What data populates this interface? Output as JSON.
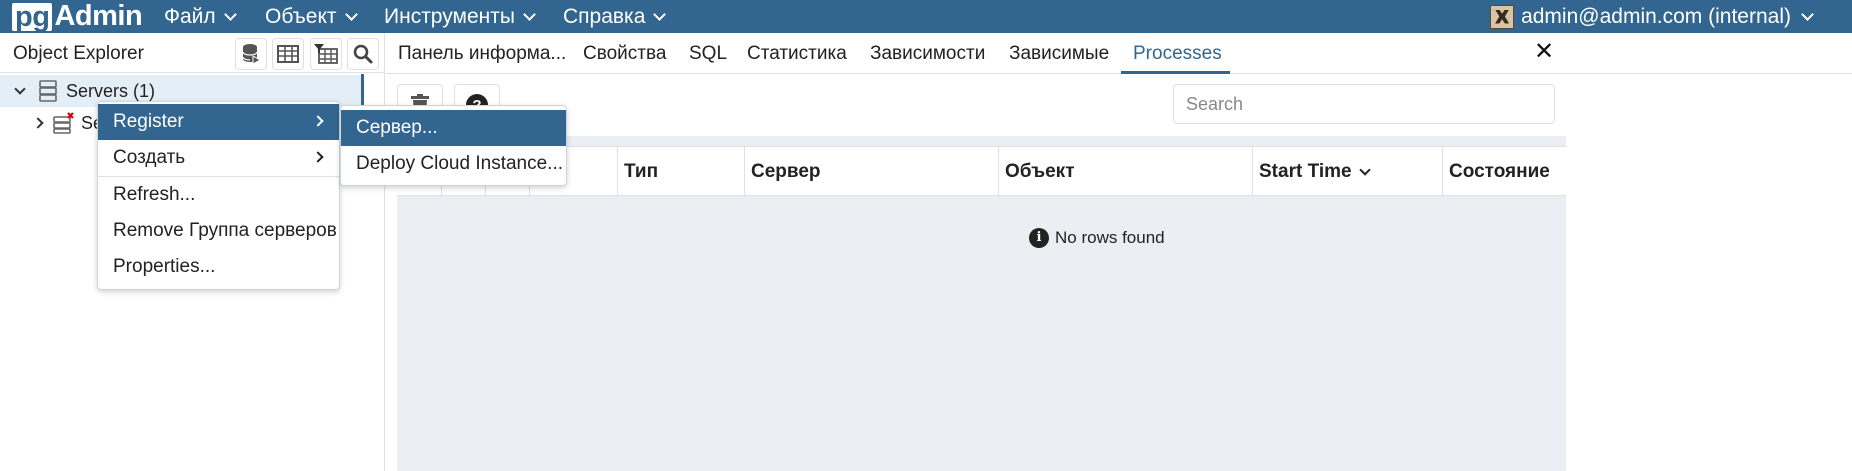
{
  "app": {
    "logo_prefix": "pg",
    "logo_suffix": "Admin",
    "brand_color": "#326690"
  },
  "topmenu": [
    {
      "label": "Файл"
    },
    {
      "label": "Объект"
    },
    {
      "label": "Инструменты"
    },
    {
      "label": "Справка"
    }
  ],
  "user": {
    "label": "admin@admin.com (internal)"
  },
  "explorer": {
    "title": "Object Explorer",
    "tools": [
      "database-icon",
      "table-icon",
      "filter-table-icon",
      "search-icon"
    ],
    "tree": [
      {
        "label": "Servers (1)",
        "expanded": true
      },
      {
        "label": "Se"
      }
    ]
  },
  "tabs": [
    {
      "label": "Панель информа..."
    },
    {
      "label": "Свойства"
    },
    {
      "label": "SQL"
    },
    {
      "label": "Статистика"
    },
    {
      "label": "Зависимости"
    },
    {
      "label": "Зависимые"
    },
    {
      "label": "Processes",
      "active": true
    }
  ],
  "close_label": "✕",
  "search": {
    "placeholder": "Search"
  },
  "grid": {
    "columns": [
      "",
      "",
      "",
      "",
      "Тип",
      "Сервер",
      "Объект",
      "Start Time",
      "Состояние"
    ],
    "sorted_column": "Start Time",
    "empty_message": "No rows found"
  },
  "context_menu": {
    "items": [
      {
        "label": "Register",
        "submenu": true,
        "highlighted": true
      },
      {
        "label": "Создать",
        "submenu": true
      },
      {
        "label": "Refresh..."
      },
      {
        "label": "Remove Группа серверов"
      },
      {
        "label": "Properties..."
      }
    ]
  },
  "submenu": {
    "items": [
      {
        "label": "Сервер...",
        "highlighted": true
      },
      {
        "label": "Deploy Cloud Instance..."
      }
    ]
  }
}
